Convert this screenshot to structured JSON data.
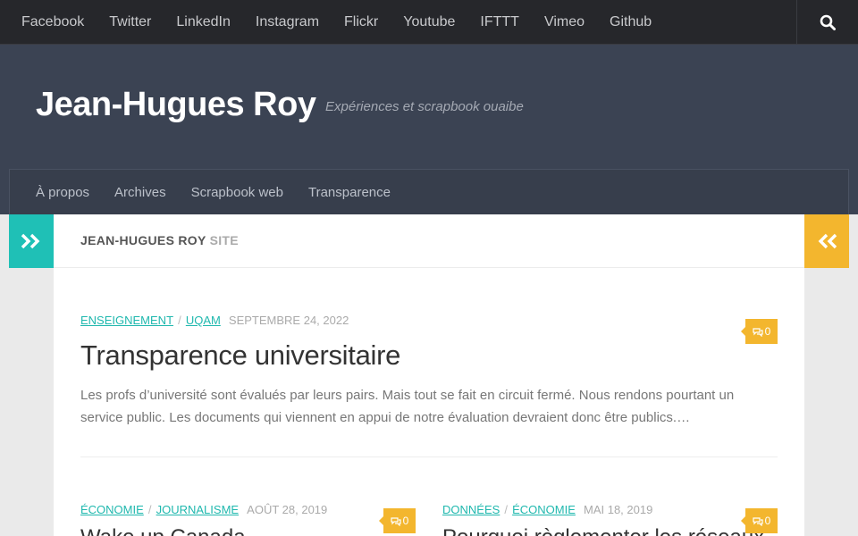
{
  "topnav": {
    "links": [
      "Facebook",
      "Twitter",
      "LinkedIn",
      "Instagram",
      "Flickr",
      "Youtube",
      "IFTTT",
      "Vimeo",
      "Github"
    ],
    "search_icon": "search-icon"
  },
  "header": {
    "site_title": "Jean-Hugues Roy",
    "tagline": "Expériences et scrapbook ouaibe"
  },
  "mainnav": {
    "items": [
      "À propos",
      "Archives",
      "Scrapbook web",
      "Transparence"
    ]
  },
  "page_header": {
    "title": "JEAN-HUGUES ROY",
    "subtitle": "SITE"
  },
  "featured_post": {
    "categories": [
      "ENSEIGNEMENT",
      "UQAM"
    ],
    "date": "SEPTEMBRE 24, 2022",
    "title": "Transparence universitaire",
    "excerpt": "Les profs d’université sont évalués par leurs pairs. Mais tout se fait en circuit fermé. Nous rendons pourtant un service public. Les documents qui viennent en appui de notre évaluation devraient donc être publics.…",
    "comments": "0"
  },
  "posts": [
    {
      "categories": [
        "ÉCONOMIE",
        "JOURNALISME"
      ],
      "date": "AOÛT 28, 2019",
      "title": "Wake up Canada",
      "comments": "0"
    },
    {
      "categories": [
        "DONNÉES",
        "ÉCONOMIE"
      ],
      "date": "MAI 18, 2019",
      "title": "Pourquoi règlementer les réseaux",
      "comments": "0"
    }
  ],
  "colors": {
    "accent_teal": "#1fc0b6",
    "accent_yellow": "#f3b62e",
    "header_bg": "#3b4353",
    "topnav_bg": "#26272b"
  }
}
